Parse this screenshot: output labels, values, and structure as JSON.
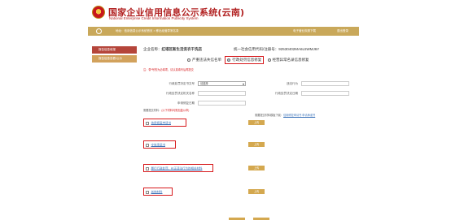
{
  "header": {
    "title_cn": "国家企业信用信息公示系统(云南)",
    "title_en": "National Enterprise Credit Information Publicity System"
  },
  "navbar": {
    "breadcrumb": "地址：信用信息公示系统首页 > 移出经营异常名录",
    "link1": "电子营业执照下载",
    "link2": "退出登录"
  },
  "sidebar": {
    "items": [
      {
        "label": "报告信息填报"
      },
      {
        "label": "报告信息查看/公示"
      }
    ]
  },
  "company": {
    "name_label": "企业名称：",
    "name_value": "红塔区新生活洗衣干洗店",
    "code_label": "统一社会信用代码/注册号：",
    "code_value": "92530402MA6L5WMJ6Y"
  },
  "radios": [
    {
      "label": "严重违法失信名单",
      "selected": false
    },
    {
      "label": "行政处罚信息修复",
      "selected": true
    },
    {
      "label": "经营异常名录信息修复",
      "selected": false
    }
  ],
  "hint": "注：带*号的为必填项，请认真填写后再提交",
  "form": {
    "fields": [
      {
        "label": "行政处罚决定书文号",
        "value": "请选择",
        "type": "select"
      },
      {
        "label": "违法行为",
        "value": "",
        "type": "input"
      },
      {
        "label": "行政处罚决定机关名称",
        "value": "",
        "type": "input"
      },
      {
        "label": "行政处罚决定日期",
        "value": "",
        "type": "input"
      },
      {
        "label": "申请修复日期",
        "value": "",
        "type": "input"
      }
    ]
  },
  "notes": {
    "left_prefix": "需要提交材料：",
    "left_red": "(以下材料均需加盖公章)",
    "right_prefix": "需要提交材料模板下载：",
    "right_link": "信用修复申请书  申请承诺书"
  },
  "documents": [
    {
      "label": "信用修复申请书",
      "upload": "上传"
    },
    {
      "label": "守信承诺书",
      "upload": "上传"
    },
    {
      "label": "履行行政处罚、纠正违法行为的相关材料",
      "upload": "上传"
    },
    {
      "label": "其他材料",
      "upload": "上传"
    }
  ]
}
